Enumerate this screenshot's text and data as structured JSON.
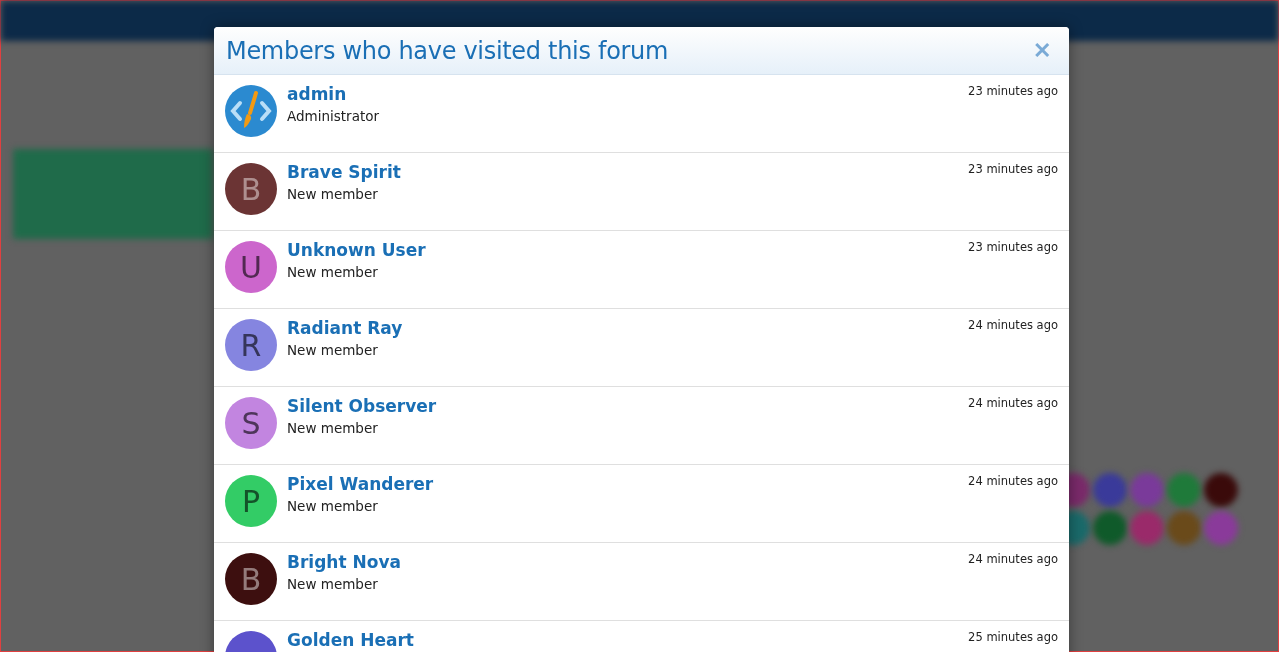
{
  "dialog": {
    "title": "Members who have visited this forum",
    "close_symbol": "✕",
    "members": [
      {
        "kind": "logo",
        "name": "admin",
        "role": "Administrator",
        "time": "23 minutes ago"
      },
      {
        "kind": "letter",
        "letter": "B",
        "color": "#6b3434",
        "name": "Brave Spirit",
        "role": "New member",
        "time": "23 minutes ago"
      },
      {
        "kind": "letter",
        "letter": "U",
        "color": "#cc66cc",
        "name": "Unknown User",
        "role": "New member",
        "time": "23 minutes ago"
      },
      {
        "kind": "letter",
        "letter": "R",
        "color": "#8585e0",
        "name": "Radiant Ray",
        "role": "New member",
        "time": "24 minutes ago"
      },
      {
        "kind": "letter",
        "letter": "S",
        "color": "#c285e0",
        "name": "Silent Observer",
        "role": "New member",
        "time": "24 minutes ago"
      },
      {
        "kind": "letter",
        "letter": "P",
        "color": "#33cc66",
        "name": "Pixel Wanderer",
        "role": "New member",
        "time": "24 minutes ago"
      },
      {
        "kind": "letter",
        "letter": "B",
        "color": "#3d0f0f",
        "name": "Bright Nova",
        "role": "New member",
        "time": "24 minutes ago"
      },
      {
        "kind": "blank",
        "color": "#5c52cc",
        "name": "Golden Heart",
        "time": "25 minutes ago"
      }
    ]
  }
}
